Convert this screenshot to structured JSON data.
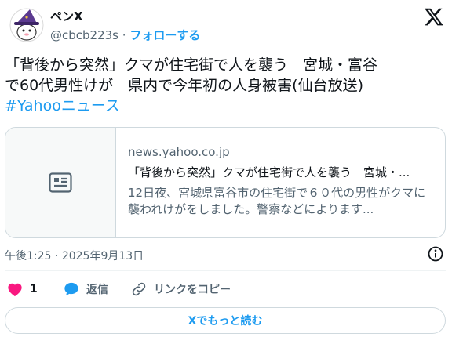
{
  "user": {
    "name": "ペンX",
    "handle": "@cbcb223s",
    "separator": "·",
    "follow_label": "フォローする"
  },
  "tweet": {
    "text_line1": "「背後から突然」クマが住宅街で人を襲う　宮城・富谷",
    "text_line2": "で60代男性けが　県内で今年初の人身被害(仙台放送)",
    "hashtag": "#Yahooニュース"
  },
  "card": {
    "domain": "news.yahoo.co.jp",
    "title": "「背後から突然」クマが住宅街で人を襲う　宮城・...",
    "description": "12日夜、宮城県富谷市の住宅街で６０代の男性がクマに襲われけがをしました。警察などによります..."
  },
  "meta": {
    "time": "午後1:25",
    "separator": "·",
    "date": "2025年9月13日"
  },
  "actions": {
    "like_count": "1",
    "reply_label": "返信",
    "copy_label": "リンクをコピー"
  },
  "readmore": {
    "label": "Xでもっと読む"
  },
  "colors": {
    "accent": "#1d9bf0",
    "like": "#f91880",
    "secondary_text": "#536471",
    "border": "#cfd9de"
  },
  "icons": [
    "x-logo-icon",
    "article-icon",
    "info-icon",
    "heart-icon",
    "reply-bubble-icon",
    "link-icon"
  ]
}
